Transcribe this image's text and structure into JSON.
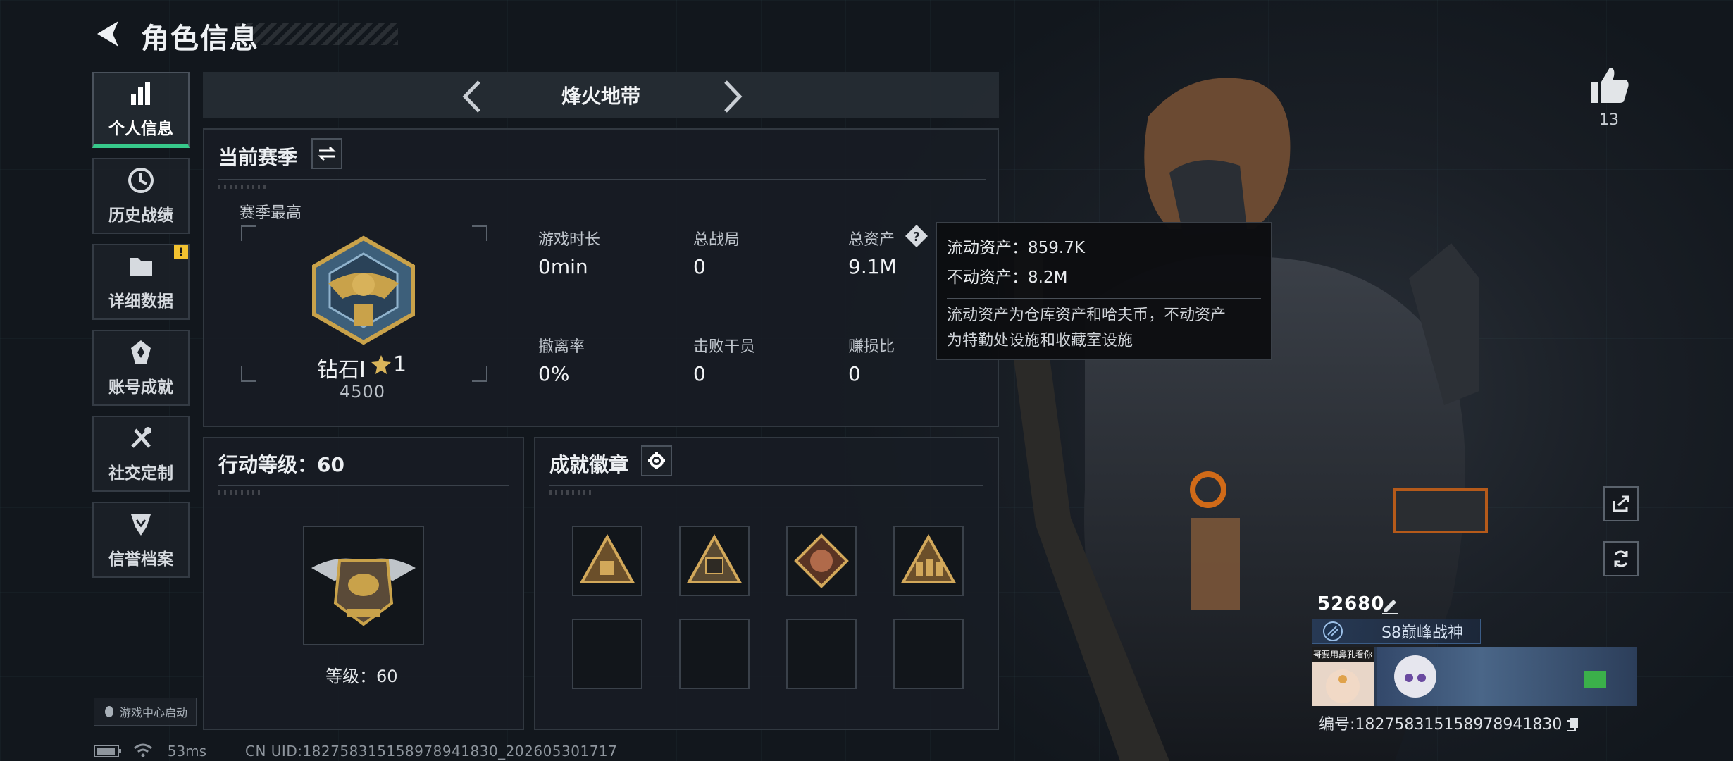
{
  "header": {
    "title": "角色信息"
  },
  "sidebar": {
    "items": [
      {
        "label": "个人信息",
        "icon": "bar-chart-icon",
        "active": true
      },
      {
        "label": "历史战绩",
        "icon": "clock-icon",
        "active": false
      },
      {
        "label": "详细数据",
        "icon": "folder-icon",
        "active": false,
        "badge": "!"
      },
      {
        "label": "账号成就",
        "icon": "achievement-icon",
        "active": false
      },
      {
        "label": "社交定制",
        "icon": "tools-icon",
        "active": false
      },
      {
        "label": "信誉档案",
        "icon": "shield-icon",
        "active": false
      }
    ],
    "launch_label": "游戏中心启动"
  },
  "mode": {
    "label": "烽火地带"
  },
  "season": {
    "title": "当前赛季",
    "best_label": "赛季最高",
    "rank_name": "钻石Ⅰ",
    "rank_stars": "1",
    "rank_score": "4500",
    "stats": [
      {
        "label": "游戏时长",
        "value": "0min"
      },
      {
        "label": "总战局",
        "value": "0"
      },
      {
        "label": "总资产",
        "value": "9.1M"
      },
      {
        "label": "撤离率",
        "value": "0%"
      },
      {
        "label": "击败干员",
        "value": "0"
      },
      {
        "label": "赚损比",
        "value": "0"
      }
    ]
  },
  "tooltip": {
    "line1": "流动资产：859.7K",
    "line2": "不动资产：8.2M",
    "desc1": "流动资产为仓库资产和哈夫币，不动资产",
    "desc2": "为特勤处设施和收藏室设施"
  },
  "level": {
    "title": "行动等级：60",
    "label": "等级：60"
  },
  "badges": {
    "title": "成就徽章",
    "items": [
      "badge-crate-icon",
      "badge-s8-icon",
      "badge-dragon-icon",
      "badge-soldiers-icon",
      "",
      "",
      "",
      ""
    ]
  },
  "right": {
    "likes": "13",
    "player_name": "52680",
    "title_plate": "S8巅峰战神",
    "avatar_caption": "哥要用鼻孔看你",
    "uid": "编号:182758315158978941830"
  },
  "footer": {
    "ping": "53ms",
    "uid": "CN UID:182758315158978941830_202605301717"
  },
  "colors": {
    "accent_green": "#37c98b",
    "warn_yellow": "#f2c230",
    "gold": "#c9a24a"
  }
}
